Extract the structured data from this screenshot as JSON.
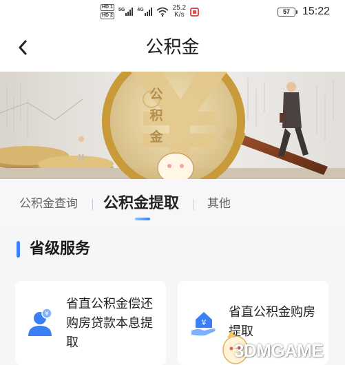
{
  "status_bar": {
    "hd1": "HD 1",
    "hd2": "HD 2",
    "net1": "5G",
    "net2": "4G",
    "speed_value": "25.2",
    "speed_unit": "K/s",
    "battery": "57",
    "time": "15:22"
  },
  "nav": {
    "title": "公积金"
  },
  "banner": {
    "glass_text": [
      "公",
      "积",
      "金"
    ]
  },
  "tabs": {
    "items": [
      {
        "label": "公积金查询",
        "active": false
      },
      {
        "label": "公积金提取",
        "active": true
      },
      {
        "label": "其他",
        "active": false
      }
    ]
  },
  "section": {
    "title": "省级服务"
  },
  "cards": [
    {
      "label": "省直公积金偿还购房贷款本息提取",
      "icon": "user-coin-icon"
    },
    {
      "label": "省直公积金购房提取",
      "icon": "house-hand-icon"
    }
  ],
  "watermark": {
    "text": "3DMGAME"
  },
  "colors": {
    "accent": "#3a7ff6",
    "banner_bg": "#e9e6e1",
    "page_bg": "#f5f6f8"
  }
}
